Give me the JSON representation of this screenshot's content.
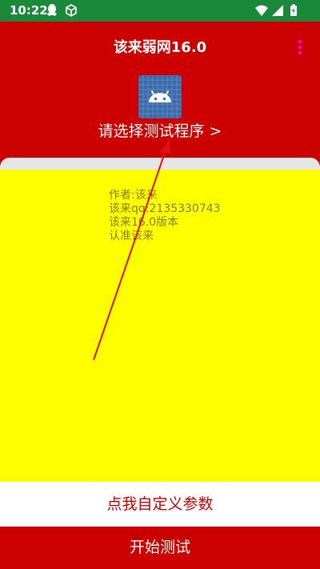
{
  "status_bar": {
    "time": "10:22",
    "icons": [
      "qq-icon",
      "cube-icon",
      "wifi-icon",
      "signal-icon",
      "battery-charging-icon"
    ]
  },
  "header": {
    "title": "该来弱网16.0",
    "menu_icon": "more-vert-icon",
    "app_icon": "android-app-icon",
    "select_program_label": "请选择测试程序 >"
  },
  "info": {
    "lines": [
      "作者:该来",
      "该来qq:2135330743",
      "该来16.0版本",
      "认准该来"
    ]
  },
  "buttons": {
    "custom_params": "点我自定义参数",
    "start_test": "开始测试"
  },
  "colors": {
    "status_bar": "#1a8a3a",
    "primary_red": "#cc0000",
    "content_yellow": "#ffff00",
    "info_text": "#808000",
    "menu_dots": "#ff00cc",
    "strip_grey": "#e6e6e8"
  }
}
